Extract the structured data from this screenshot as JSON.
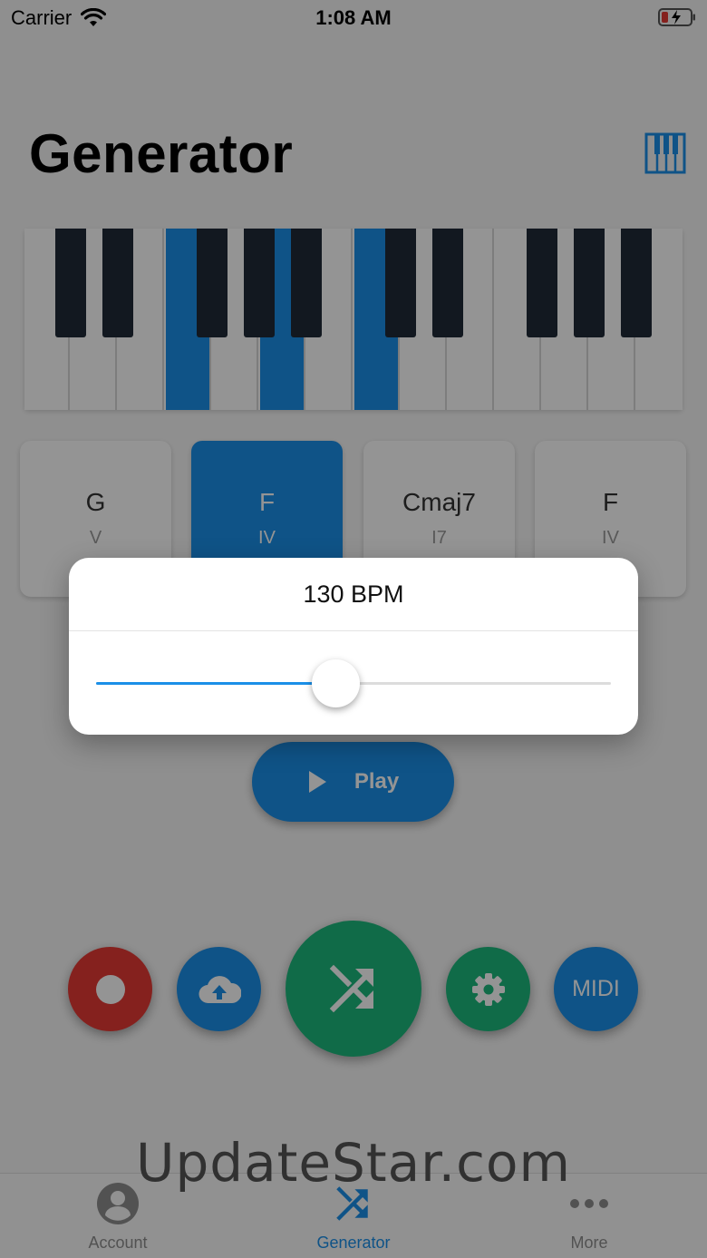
{
  "status_bar": {
    "carrier": "Carrier",
    "time": "1:08 AM",
    "icons": [
      "wifi-icon",
      "battery-charging-icon"
    ]
  },
  "header": {
    "title": "Generator",
    "piano_toggle_icon": "piano-icon"
  },
  "keyboard": {
    "white_key_count": 14,
    "active_white_keys": [
      3,
      5,
      7
    ]
  },
  "chords": [
    {
      "name": "G",
      "degree": "V",
      "active": false
    },
    {
      "name": "F",
      "degree": "IV",
      "active": true
    },
    {
      "name": "Cmaj7",
      "degree": "I7",
      "active": false
    },
    {
      "name": "F",
      "degree": "IV",
      "active": false
    }
  ],
  "tempo_dialog": {
    "title": "130 BPM",
    "slider_value": 0.465
  },
  "play": {
    "label": "Play",
    "icon": "play-icon"
  },
  "actions": [
    {
      "id": "record",
      "icon": "record-icon",
      "color": "#e53935"
    },
    {
      "id": "upload",
      "icon": "cloud-upload-icon",
      "color": "#1a8fe8"
    },
    {
      "id": "shuffle",
      "icon": "shuffle-icon",
      "color": "#1db87d"
    },
    {
      "id": "settings",
      "icon": "gear-icon",
      "color": "#1db87d"
    },
    {
      "id": "midi",
      "label": "MIDI",
      "color": "#1a8fe8"
    }
  ],
  "tabs": [
    {
      "label": "Account",
      "icon": "account-icon",
      "active": false
    },
    {
      "label": "Generator",
      "icon": "shuffle-icon",
      "active": true
    },
    {
      "label": "More",
      "icon": "more-dots-icon",
      "active": false
    }
  ],
  "watermark": "UpdateStar.com",
  "colors": {
    "accent": "#1a8fe8",
    "green": "#1db87d",
    "red": "#e53935"
  }
}
